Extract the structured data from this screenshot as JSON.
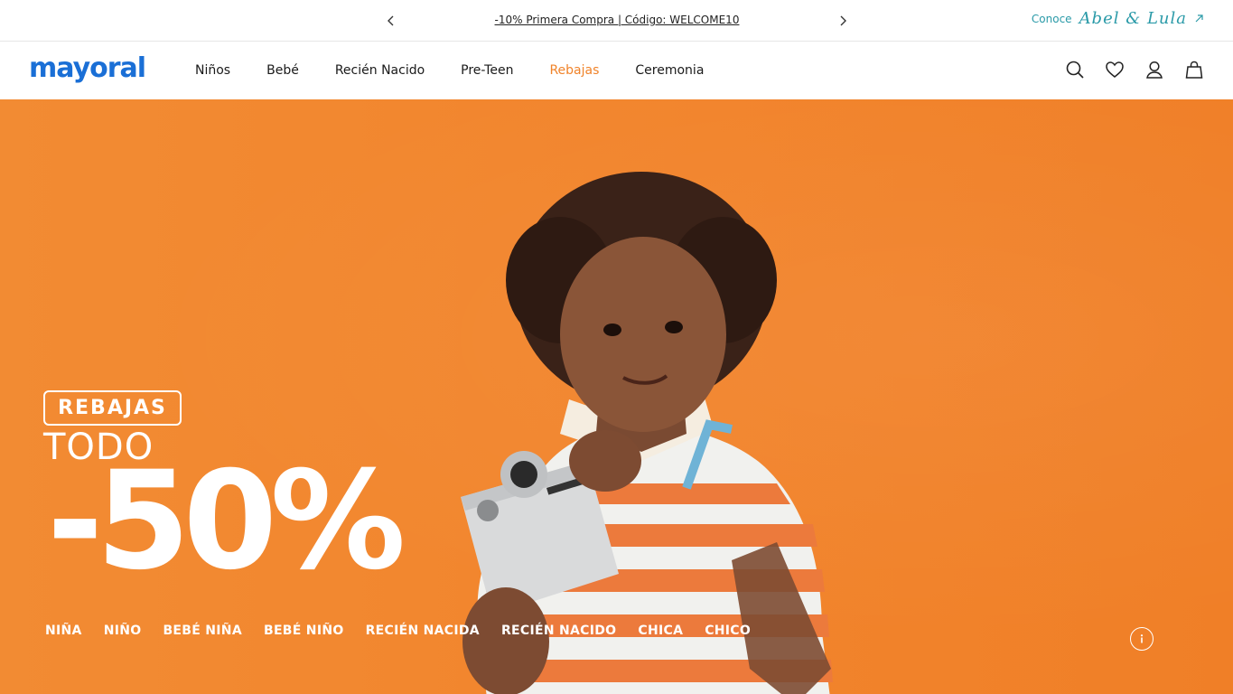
{
  "announcement": {
    "promo_text": "-10% Primera Compra | Código: WELCOME10",
    "prev_icon": "chevron-left-icon",
    "next_icon": "chevron-right-icon",
    "conoce_label": "Conoce",
    "conoce_brand": "Abel & Lula",
    "conoce_icon": "external-arrow-icon"
  },
  "header": {
    "logo": "mayoral",
    "nav": [
      {
        "label": "Niños"
      },
      {
        "label": "Bebé"
      },
      {
        "label": "Recién Nacido"
      },
      {
        "label": "Pre-Teen"
      },
      {
        "label": "Rebajas"
      },
      {
        "label": "Ceremonia"
      }
    ],
    "icons": [
      "search-icon",
      "heart-icon",
      "user-icon",
      "bag-icon"
    ]
  },
  "hero": {
    "badge": "REBAJAS",
    "todo": "TODO",
    "discount": "-50%",
    "categories": [
      "NIÑA",
      "NIÑO",
      "BEBÉ NIÑA",
      "BEBÉ NIÑO",
      "RECIÉN NACIDA",
      "RECIÉN NACIDO",
      "CHICA",
      "CHICO"
    ],
    "info_icon": "info-icon"
  },
  "colors": {
    "accent": "#f2852d",
    "brand_blue": "#1a6fd6",
    "sale_nav": "#f0832a",
    "abel_lula_teal": "#2a9aa8"
  }
}
